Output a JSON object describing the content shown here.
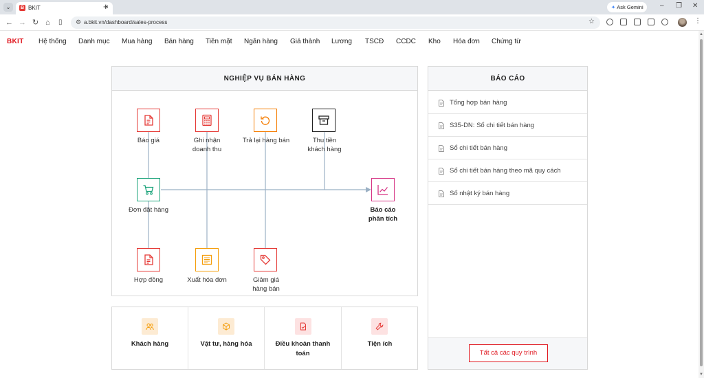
{
  "browser": {
    "tab_title": "BKIT",
    "tab_favicon_letter": "B",
    "url": "a.bkit.vn/dashboard/sales-process",
    "gemini_label": "Ask Gemini"
  },
  "navbar": {
    "logo": "BKIT",
    "menu": [
      "Hệ thống",
      "Danh mục",
      "Mua hàng",
      "Bán hàng",
      "Tiền mặt",
      "Ngân hàng",
      "Giá thành",
      "Lương",
      "TSCĐ",
      "CCDC",
      "Kho",
      "Hóa đơn",
      "Chứng từ"
    ]
  },
  "process": {
    "title": "NGHIỆP VỤ BÁN HÀNG",
    "nodes": {
      "bao_gia": {
        "label": "Báo giá",
        "icon": "document-icon",
        "color": "#e53935"
      },
      "ghi_nhan_1": {
        "label": "Ghi nhận",
        "icon": "calculator-icon",
        "color": "#e53935"
      },
      "ghi_nhan_2": {
        "label": "doanh thu"
      },
      "tra_lai": {
        "label": "Trả lại hàng bán",
        "icon": "undo-icon",
        "color": "#f57c00"
      },
      "thu_tien_1": {
        "label": "Thu tiền",
        "icon": "archive-icon",
        "color": "#222222"
      },
      "thu_tien_2": {
        "label": "khách hàng"
      },
      "don_dat_hang": {
        "label": "Đơn đặt hàng",
        "icon": "cart-icon",
        "color": "#1aa37a"
      },
      "bao_cao_1": {
        "label": "Báo cáo",
        "icon": "chart-icon",
        "color": "#d63384"
      },
      "bao_cao_2": {
        "label": "phân tích"
      },
      "hop_dong": {
        "label": "Hợp đồng",
        "icon": "document-icon",
        "color": "#e53935"
      },
      "xuat_hoa_don": {
        "label": "Xuất hóa đơn",
        "icon": "invoice-icon",
        "color": "#f59e0b"
      },
      "giam_gia_1": {
        "label": "Giảm giá",
        "icon": "tag-icon",
        "color": "#e53935"
      },
      "giam_gia_2": {
        "label": "hàng bán"
      }
    }
  },
  "tiles": [
    {
      "label": "Khách hàng",
      "icon": "users-icon",
      "color": "#f59e0b"
    },
    {
      "label": "Vật tư, hàng hóa",
      "icon": "box-icon",
      "color": "#f59e0b"
    },
    {
      "label_1": "Điều khoản thanh",
      "label_2": "toán",
      "icon": "file-check-icon",
      "color": "#e53935"
    },
    {
      "label": "Tiện ích",
      "icon": "wrench-icon",
      "color": "#e53935"
    }
  ],
  "report": {
    "title": "BÁO CÁO",
    "items": [
      "Tổng hợp bán hàng",
      "S35-DN: Sổ chi tiết bán hàng",
      "Sổ chi tiết bán hàng",
      "Sổ chi tiết bán hàng theo mã quy cách",
      "Sổ nhật ký bán hàng"
    ],
    "button": "Tất cả các quy trình"
  }
}
